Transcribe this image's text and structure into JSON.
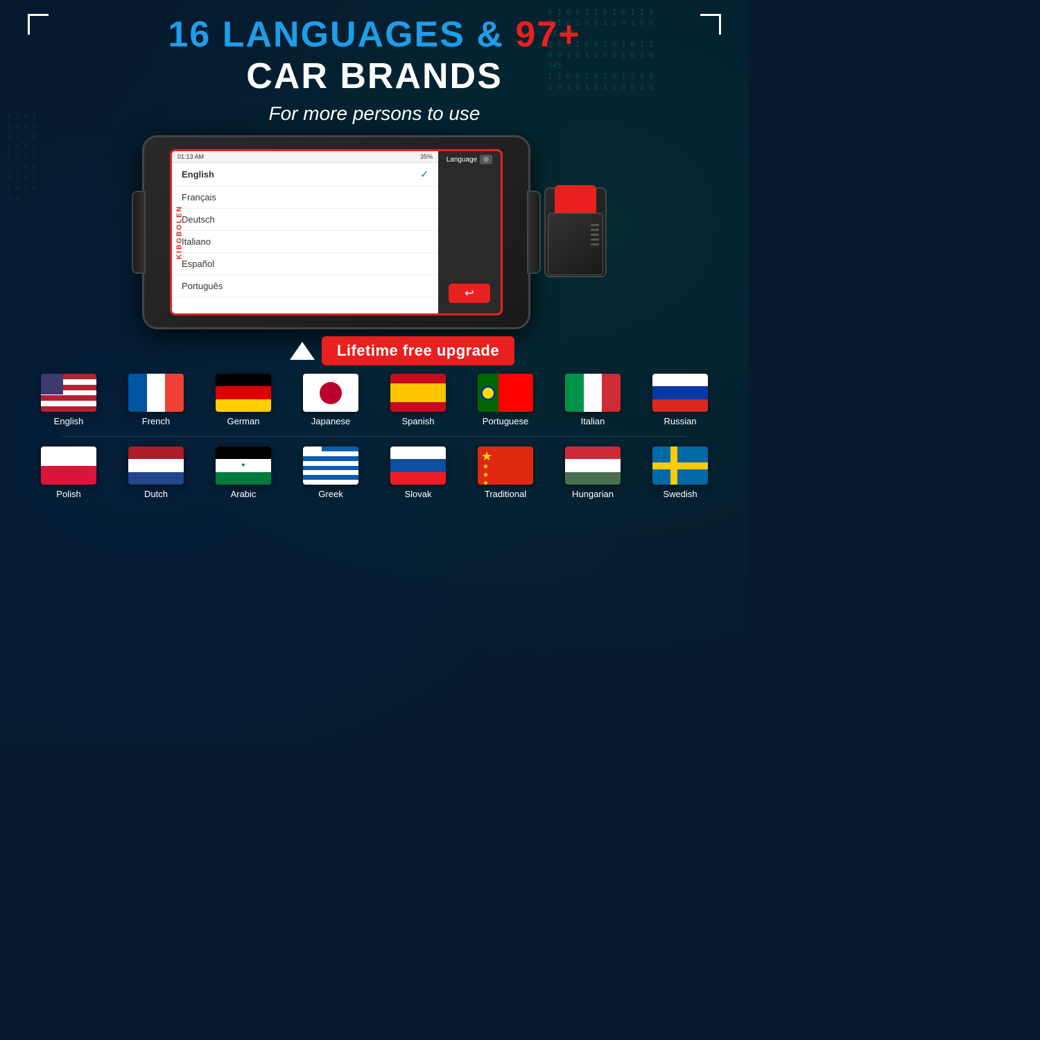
{
  "header": {
    "title_part1": "16",
    "title_middle": " LANGUAGES &",
    "title_highlight": "97+",
    "title_line2": "CAR BRANDS",
    "subtitle": "For more persons to use"
  },
  "scanner": {
    "brand": "KIBGBOLEN",
    "time": "01:13 AM",
    "battery": "35%",
    "language_label": "Language"
  },
  "screen_languages": {
    "selected": "English",
    "list": [
      "English",
      "Français",
      "Deutsch",
      "Italiano",
      "Español",
      "Português"
    ]
  },
  "upgrade": {
    "label": "Lifetime free upgrade"
  },
  "language_grid": {
    "row1": [
      {
        "name": "English",
        "flag": "us"
      },
      {
        "name": "French",
        "flag": "fr"
      },
      {
        "name": "German",
        "flag": "de"
      },
      {
        "name": "Japanese",
        "flag": "jp"
      },
      {
        "name": "Spanish",
        "flag": "es"
      },
      {
        "name": "Portuguese",
        "flag": "pt"
      },
      {
        "name": "Italian",
        "flag": "it"
      },
      {
        "name": "Russian",
        "flag": "ru"
      }
    ],
    "row2": [
      {
        "name": "Polish",
        "flag": "pl"
      },
      {
        "name": "Dutch",
        "flag": "nl"
      },
      {
        "name": "Arabic",
        "flag": "ar"
      },
      {
        "name": "Greek",
        "flag": "gr"
      },
      {
        "name": "Slovak",
        "flag": "sk"
      },
      {
        "name": "Traditional",
        "flag": "cn"
      },
      {
        "name": "Hungarian",
        "flag": "hu"
      },
      {
        "name": "Swedish",
        "flag": "se"
      }
    ]
  },
  "bg": {
    "numbers": "0 1 0 0 1 1 0 1 0 1 1 0 0 1 0 1 0 0 1 1 0 1 0 0 1 0 1 1 0 0 1 0 1 0 1 1 0 0 1 25.425 345 1 0 0 1 1 0 1 0 1 0 1 1 0 0 1 0 1 1 0 0 1 0 1 0 1 1 0 0 1 0 1 0 1"
  }
}
